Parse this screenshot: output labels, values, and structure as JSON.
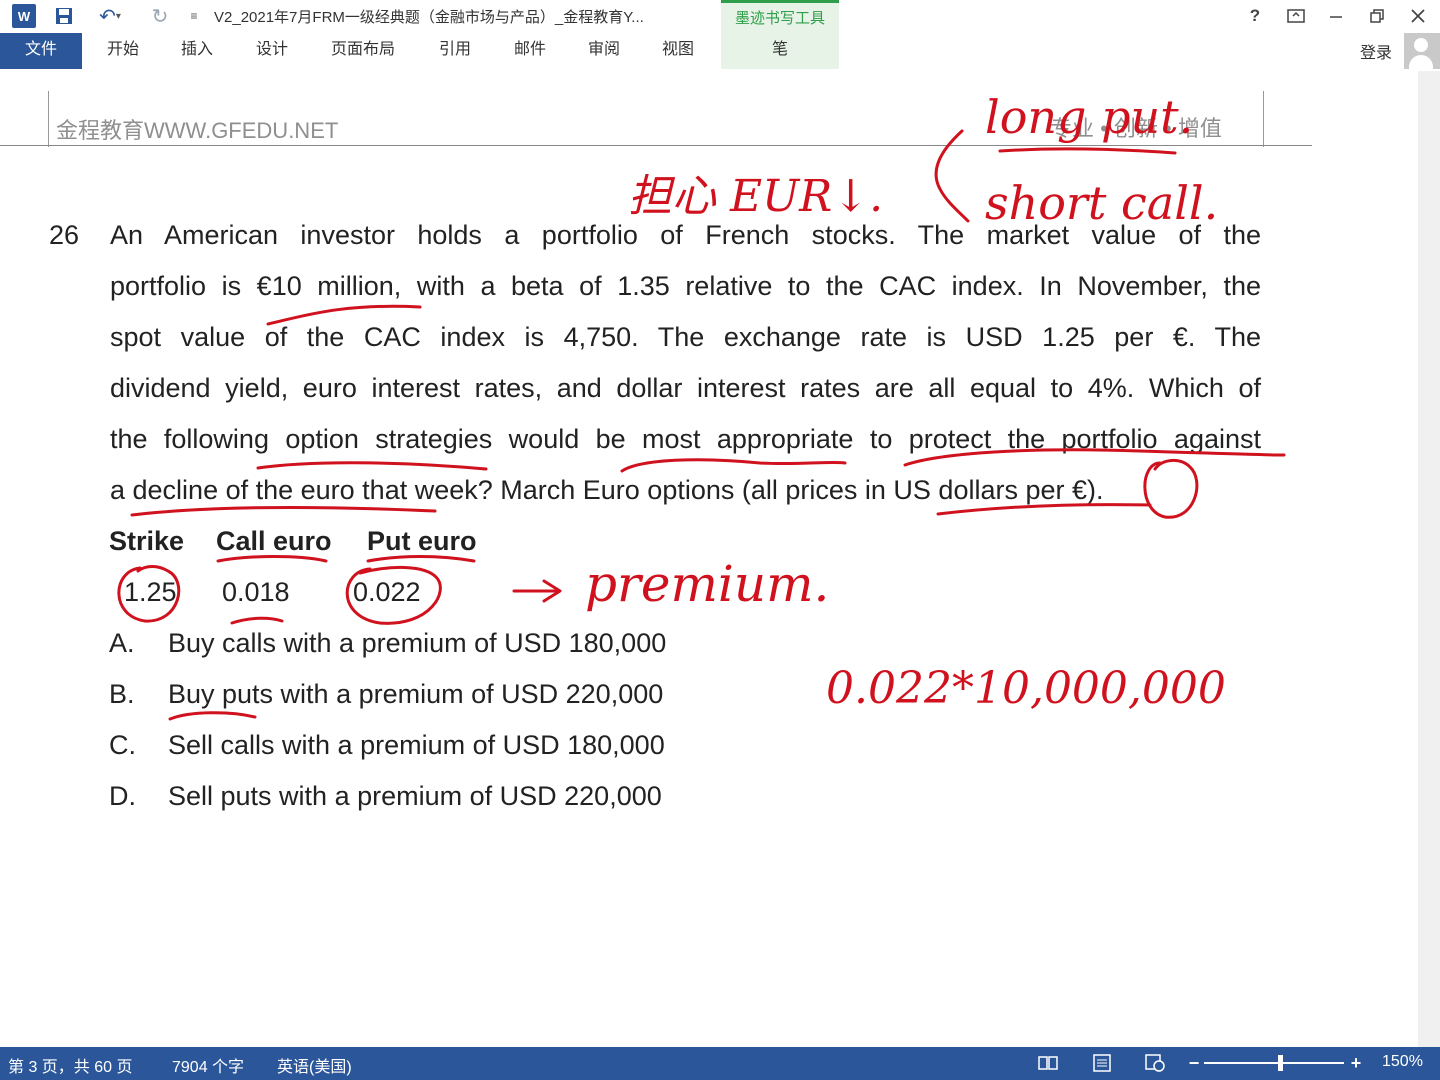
{
  "app": {
    "logo_letter": "W",
    "doc_title": "V2_2021年7月FRM一级经典题（金融市场与产品）_金程教育Y...",
    "ink_tools_label": "墨迹书写工具",
    "help": "?",
    "login": "登录"
  },
  "tabs": [
    {
      "label": "文件"
    },
    {
      "label": "开始"
    },
    {
      "label": "插入"
    },
    {
      "label": "设计"
    },
    {
      "label": "页面布局"
    },
    {
      "label": "引用"
    },
    {
      "label": "邮件"
    },
    {
      "label": "审阅"
    },
    {
      "label": "视图"
    },
    {
      "label": "笔"
    }
  ],
  "header": {
    "left": "金程教育WWW.GFEDU.NET",
    "right": "专业 • 创新 • 增值"
  },
  "question": {
    "number": "26",
    "lines": [
      "An American investor holds a portfolio of French stocks. The market value of the",
      "portfolio is €10 million, with a beta of 1.35 relative to the CAC index. In November, the",
      "spot value of the CAC index is 4,750. The exchange rate is USD 1.25 per €. The",
      "dividend yield, euro interest rates, and dollar interest rates are all equal to 4%. Which of",
      "the following option strategies would be most appropriate to protect the portfolio against",
      "a decline of the euro that week? March Euro options (all prices in US dollars per €)."
    ],
    "table": {
      "headers": [
        "Strike",
        "Call euro",
        "Put euro"
      ],
      "row": [
        "1.25",
        "0.018",
        "0.022"
      ]
    },
    "options": [
      {
        "letter": "A.",
        "text": "Buy calls with a premium of USD 180,000"
      },
      {
        "letter": "B.",
        "text": "Buy puts with a premium of USD 220,000"
      },
      {
        "letter": "C.",
        "text": "Sell calls with a premium of USD 180,000"
      },
      {
        "letter": "D.",
        "text": "Sell puts with a premium of USD 220,000"
      }
    ]
  },
  "annotations": {
    "top_note": "担心 EUR↓.",
    "long_put": "long put.",
    "short_call": "short call.",
    "premium": "premium.",
    "calc": "0.022*10,000,000"
  },
  "status": {
    "page": "第 3 页，共 60 页",
    "words": "7904 个字",
    "language": "英语(美国)",
    "zoom": "150%"
  },
  "colors": {
    "ribbon_blue": "#2b579a",
    "ink_red": "#d0121e",
    "ink_tools_green": "#2e9e4a"
  }
}
